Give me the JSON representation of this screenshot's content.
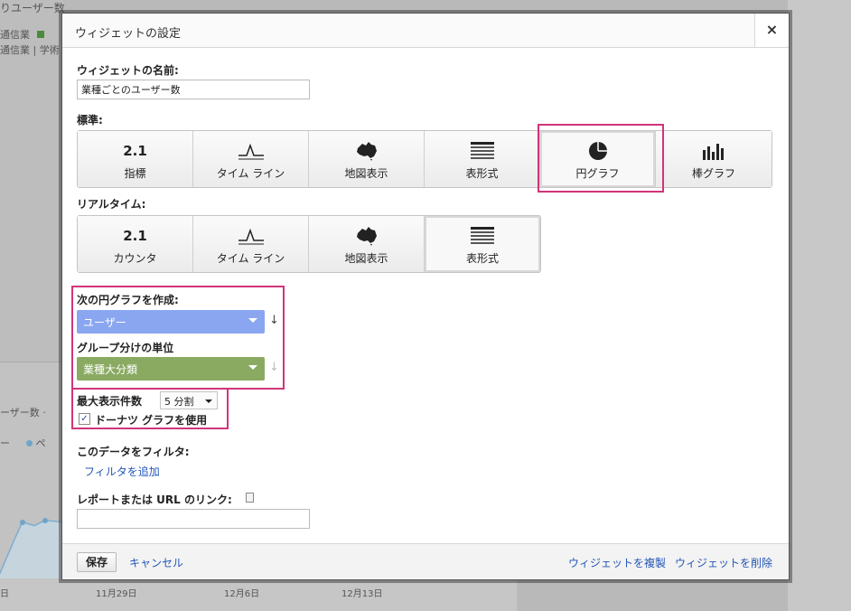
{
  "background": {
    "title_fragment": "りユーザー数",
    "legend_1": "通信業",
    "legend_2": "通信業 | 学術",
    "section_label": "ーザー数 ·",
    "series_label": "ー",
    "series_label_2": "ペ",
    "axis_labels": [
      "日",
      "11月29日",
      "12月6日",
      "12月13日"
    ]
  },
  "dialog": {
    "title": "ウィジェットの設定",
    "close_label": "×",
    "name_label": "ウィジェットの名前:",
    "name_value": "業種ごとのユーザー数",
    "standard_label": "標準:",
    "standard_types": [
      {
        "icon_text": "2.1",
        "label": "指標"
      },
      {
        "icon_text": "",
        "label": "タイム ライン"
      },
      {
        "icon_text": "",
        "label": "地図表示"
      },
      {
        "icon_text": "",
        "label": "表形式"
      },
      {
        "icon_text": "",
        "label": "円グラフ"
      },
      {
        "icon_text": "",
        "label": "棒グラフ"
      }
    ],
    "realtime_label": "リアルタイム:",
    "realtime_types": [
      {
        "icon_text": "2.1",
        "label": "カウンタ"
      },
      {
        "icon_text": "",
        "label": "タイム ライン"
      },
      {
        "icon_text": "",
        "label": "地図表示"
      },
      {
        "icon_text": "",
        "label": "表形式"
      }
    ],
    "pie_create_label": "次の円グラフを作成:",
    "metric_value": "ユーザー",
    "group_label": "グループ分けの単位",
    "group_value": "業種大分類",
    "max_label": "最大表示件数",
    "max_value": "5 分割",
    "donut_label": "ドーナツ グラフを使用",
    "donut_checked": "✓",
    "filter_label": "このデータをフィルタ:",
    "add_filter_link": "フィルタを追加",
    "report_link_label": "レポートまたは URL のリンク:",
    "report_link_value": "",
    "save_label": "保存",
    "cancel_label": "キャンセル",
    "duplicate_label": "ウィジェットを複製",
    "delete_label": "ウィジェットを削除",
    "colors": {
      "metric_dropdown": "#8aa6f0",
      "group_dropdown": "#8aaa62",
      "highlight": "#d0357a",
      "link": "#2356b6"
    }
  }
}
